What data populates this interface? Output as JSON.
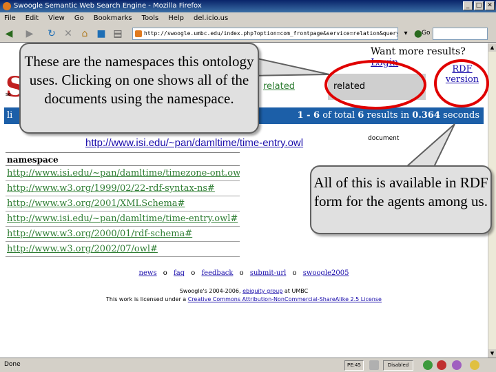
{
  "window": {
    "title": "Swoogle Semantic Web Search Engine - Mozilla Firefox",
    "buttons": [
      "_",
      "□",
      "✕"
    ]
  },
  "menu": [
    "File",
    "Edit",
    "View",
    "Go",
    "Bookmarks",
    "Tools",
    "Help",
    "del.icio.us"
  ],
  "toolbar": {
    "url": "http://swoogle.umbc.edu/index.php?option=com_frontpage&service=relation&queryType=rel_swd_ns&searchString=",
    "go_label": "Go"
  },
  "page": {
    "more_results_prefix": "Want more results?",
    "more_results_link": "Login",
    "logo_letter": "S",
    "logo_small": "se",
    "tab_related_terms": "related terms",
    "tab_related_namespaces": "related namespaces",
    "rdf_version": "RDF version",
    "bluebar_left": "li",
    "bluebar_right_prefix": "1 - 6",
    "bluebar_right_mid": "of total",
    "bluebar_right_count": "6",
    "bluebar_right_results": "results in",
    "bluebar_right_time": "0.364",
    "bluebar_right_suffix": "seconds",
    "ontology_url": "http://www.isi.edu/~pan/damltime/time-entry.owl",
    "ontology_type": "document",
    "table_header": "namespace",
    "namespaces": [
      "http://www.isi.edu/~pan/damltime/timezone-ont.owl#",
      "http://www.w3.org/1999/02/22-rdf-syntax-ns#",
      "http://www.w3.org/2001/XMLSchema#",
      "http://www.isi.edu/~pan/damltime/time-entry.owl#",
      "http://www.w3.org/2000/01/rdf-schema#",
      "http://www.w3.org/2002/07/owl#"
    ],
    "footer_links": [
      "news",
      "faq",
      "feedback",
      "submit-url",
      "swoogle2005"
    ],
    "footer_sep": "o",
    "footer_line1": "Swoogle's 2004-2006,",
    "footer_line1_link": "ebiquity group",
    "footer_line1_suffix": "at UMBC",
    "footer_line2_prefix": "This work is licensed under a",
    "footer_line2_link": "Creative Commons Attribution-NonCommercial-ShareAlike 2.5 License"
  },
  "status": {
    "text": "Done",
    "cell_1": "PE:45",
    "cell_2": "Disabled"
  },
  "callouts": {
    "namespaces_note": "These are the namespaces this ontology uses.  Clicking on one shows all of the documents using the namespace.",
    "rdf_note": "All of this is available in RDF form for the agents among us."
  },
  "colors": {
    "callout_fill": "#e0e0e0",
    "highlight_ring": "#e00000",
    "bluebar": "#1c5fa8",
    "namespace_link": "#2e7d32"
  }
}
